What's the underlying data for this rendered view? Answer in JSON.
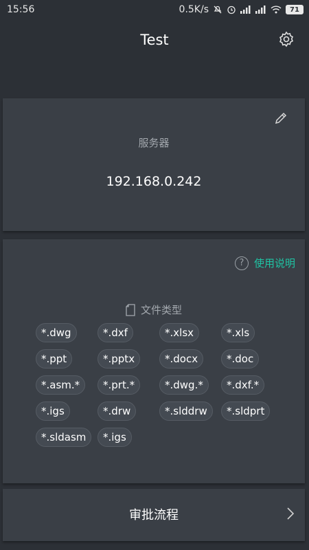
{
  "status_bar": {
    "time": "15:56",
    "net_speed": "0.5K/s",
    "battery": "71"
  },
  "header": {
    "title": "Test"
  },
  "server_card": {
    "label": "服务器",
    "value": "192.168.0.242"
  },
  "types_card": {
    "help_label": "使用说明",
    "help_icon_glyph": "?",
    "heading": "文件类型",
    "file_types": [
      "*.dwg",
      "*.dxf",
      "*.xlsx",
      "*.xls",
      "*.ppt",
      "*.pptx",
      "*.docx",
      "*.doc",
      "*.asm.*",
      "*.prt.*",
      "*.dwg.*",
      "*.dxf.*",
      "*.igs",
      "*.drw",
      "*.slddrw",
      "*.sldprt",
      "*.sldasm",
      "*.igs"
    ]
  },
  "approval_card": {
    "label": "审批流程"
  },
  "colors": {
    "background": "#2c3036",
    "card": "#3a3f46",
    "accent": "#1fc4a4",
    "muted_text": "#a3a8ae"
  }
}
